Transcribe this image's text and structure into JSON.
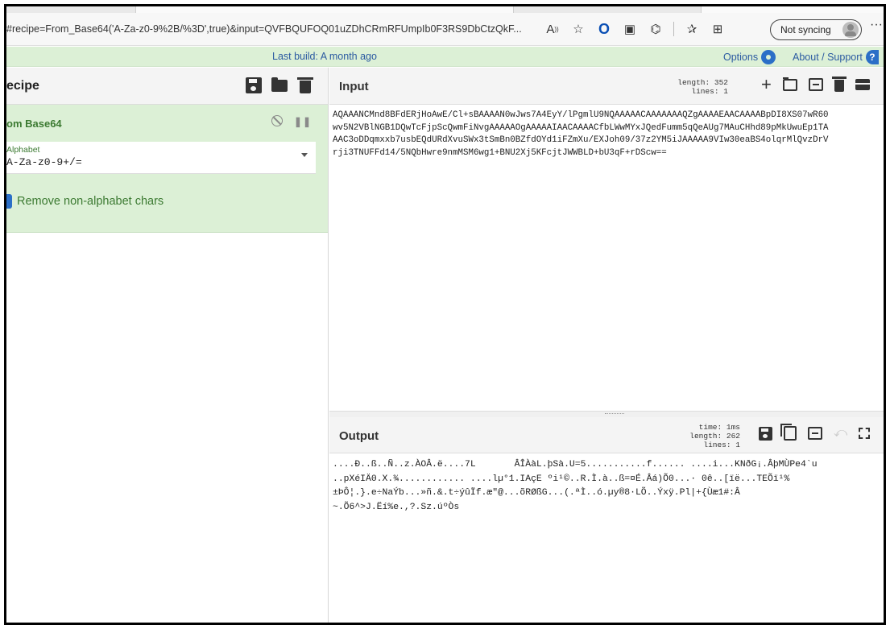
{
  "browser": {
    "url": "#recipe=From_Base64('A-Za-z0-9%2B/%3D',true)&input=QVFBQUFOQ01uZDhCRmRFUmpIb0F3RS9DbCtzQkF...",
    "sync_label": "Not syncing",
    "icons": [
      "read-aloud-icon",
      "favorite-star-icon",
      "opera-icon",
      "extension-icon",
      "extensions-puzzle-icon",
      "favorites-icon",
      "collections-icon",
      "avatar-icon",
      "more-icon"
    ]
  },
  "banner": {
    "build": "Last build: A month ago",
    "options": "Options",
    "about": "About / Support"
  },
  "recipe": {
    "title": "ecipe",
    "operation": {
      "name": "om Base64",
      "alphabet_label": "Alphabet",
      "alphabet_value": "A-Za-z0-9+/=",
      "checkbox_label": "Remove non-alphabet chars"
    }
  },
  "input": {
    "title": "Input",
    "length_label": "length:",
    "length_value": "352",
    "lines_label": "lines:",
    "lines_value": "1",
    "lines": [
      "AQAAANCMnd8BFdERjHoAwE/Cl+sBAAAAN0wJws7A4EyY/lPgmlU9NQAAAAACAAAAAAAQZgAAAAEAACAAAABpDI8XS07wR60",
      "wv5N2VBlNGB1DQwTcFjpScQwmFiNvgAAAAAOgAAAAAIAACAAAACfbLWwMYxJQedFumm5qQeAUg7MAuCHhd89pMkUwuEp1TA",
      "AAC3oDDqmxxb7usbEQdURdXvuSWx3tSmBn0BZfdOYd1iFZmXu/EXJoh09/37z2YM5iJAAAAA9VIw30eaBS4olqrMlQvzDrV",
      "rji3TNUFFd14/5NQbHwre9nmMSM6wg1+BNU2Xj5KFcjtJWWBLD+bU3qF+rDScw=="
    ]
  },
  "output": {
    "title": "Output",
    "time_label": "time:",
    "time_value": "1ms",
    "length_label": "length:",
    "length_value": "262",
    "lines_label": "lines:",
    "lines_value": "1",
    "lines": [
      "....Ð..ß..Ñ..z.ÀOÂ.ë....7L       ÂÎÀàL.þSà.U=5...........f...... ....i...KNðG¡.ÂþMÙPe4`u",
      "..pXéIÄ0.X.¾............ ....lµ°1.IAçE ºi¹©..R.Ì.à..ß=¤É.Âá)Õ0...· 0ê..[ïë...TEÕï¹%",
      "±ÞÔ¦.}.e÷NaÝb...»ñ.&.t÷ýûÏf.æ\"@...õRØßG...(.ªÌ..ó.µy®8·LÕ..Ýxÿ.Pl|+{Ùæ1#:Â",
      "~.Õ6^>J.Ëí%e.,?.Sz.úºÒs"
    ]
  }
}
